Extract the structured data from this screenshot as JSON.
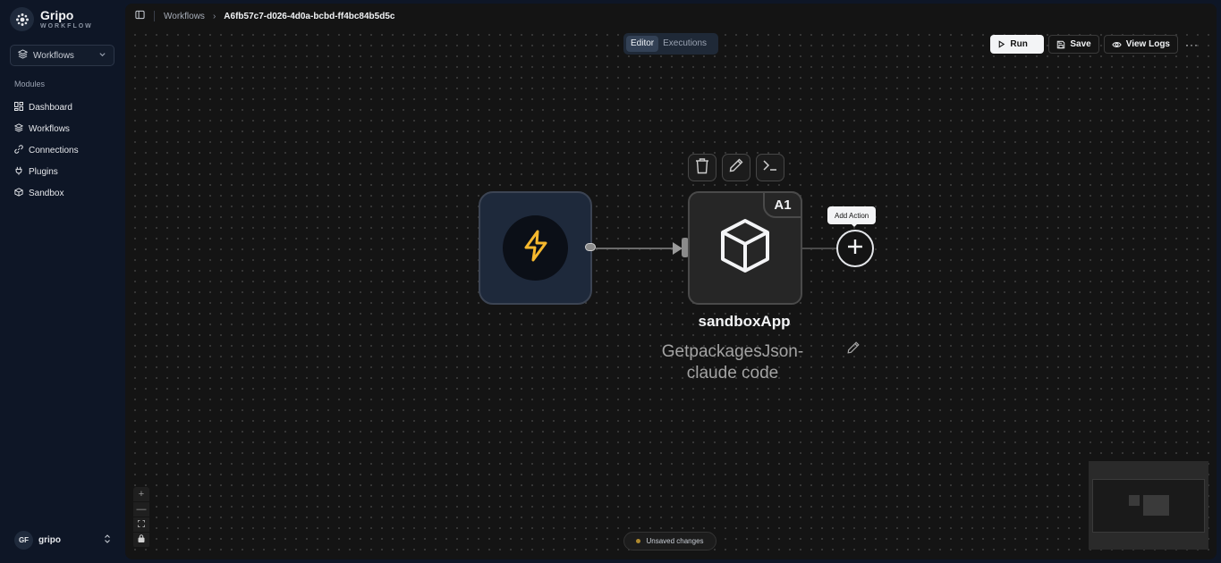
{
  "brand": {
    "name": "Gripo",
    "subtitle": "WORKFLOW"
  },
  "workspace_select": {
    "value": "Workflows"
  },
  "sidebar": {
    "section_title": "Modules",
    "items": [
      {
        "label": "Dashboard",
        "icon": "dashboard-icon"
      },
      {
        "label": "Workflows",
        "icon": "layers-icon"
      },
      {
        "label": "Connections",
        "icon": "link-icon"
      },
      {
        "label": "Plugins",
        "icon": "plug-icon"
      },
      {
        "label": "Sandbox",
        "icon": "cube-icon"
      }
    ]
  },
  "user": {
    "initials": "GF",
    "name": "gripo"
  },
  "breadcrumb": {
    "parent": "Workflows",
    "current": "A6fb57c7-d026-4d0a-bcbd-ff4bc84b5d5c"
  },
  "mode_tabs": {
    "editor": "Editor",
    "executions": "Executions",
    "active": "Editor"
  },
  "toolbar": {
    "run_label": "Run",
    "save_label": "Save",
    "logs_label": "View Logs",
    "more": "···"
  },
  "nodes": {
    "trigger": {
      "icon": "lightning-icon",
      "accent": "#f5b82e"
    },
    "action": {
      "badge": "A1",
      "title": "sandboxApp",
      "description": "GetpackagesJson-claude code",
      "icon": "cube-icon"
    }
  },
  "add_action": {
    "tooltip": "Add Action"
  },
  "zoom_controls": {
    "zoom_in": "+",
    "zoom_out": "—",
    "fit": "⛶",
    "lock": "🔒"
  },
  "status": {
    "text": "Unsaved changes",
    "color": "#b08a2e"
  }
}
